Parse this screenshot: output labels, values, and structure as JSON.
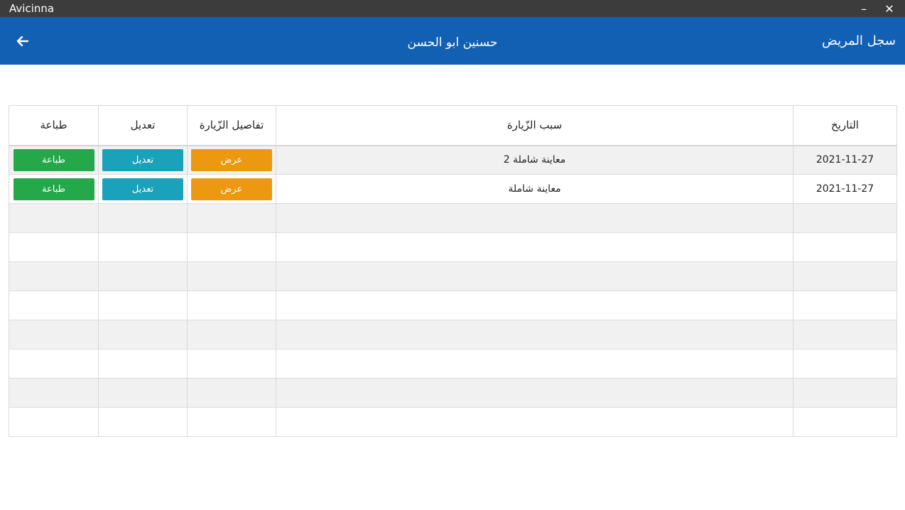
{
  "window": {
    "app_name": "Avicinna",
    "minimize_glyph": "–",
    "close_glyph": "✕"
  },
  "header": {
    "patient_name": "حسنين ابو الحسن",
    "section_title": "سجل المريض",
    "back_icon": "arrow-left-icon"
  },
  "table": {
    "columns": [
      "التاريخ",
      "سبب الزّيارة",
      "تفاصيل الزّيارة",
      "تعديل",
      "طباعة"
    ],
    "rows": [
      {
        "date": "2021-11-27",
        "reason": "معاينة شاملة 2",
        "view": "عرض",
        "edit": "تعديل",
        "print": "طباعة"
      },
      {
        "date": "2021-11-27",
        "reason": "معاينة شاملة",
        "view": "عرض",
        "edit": "تعديل",
        "print": "طباعة"
      }
    ],
    "empty_row_count": 8
  },
  "colors": {
    "header": "#1160b4",
    "titlebar": "#3c3c3c",
    "view_button": "#ec9911",
    "edit_button": "#1aa2ba",
    "print_button": "#25a84a"
  }
}
